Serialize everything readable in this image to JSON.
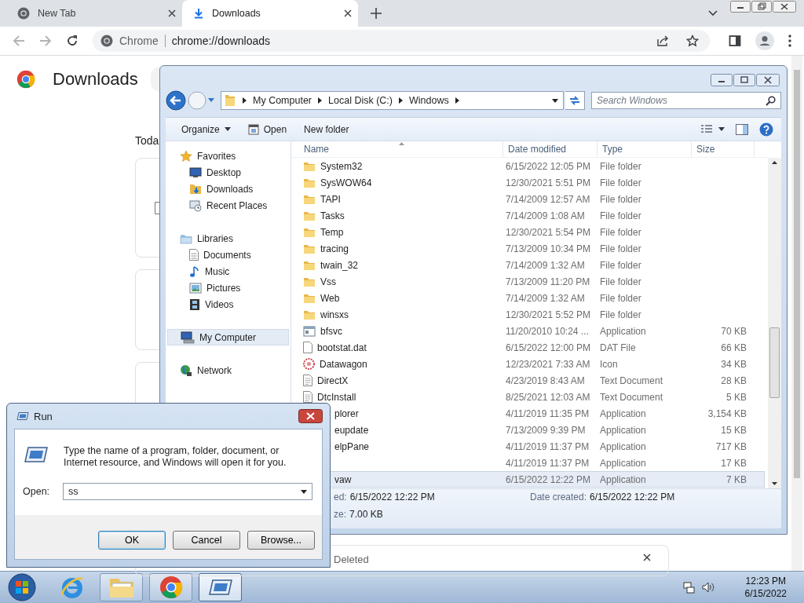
{
  "browser": {
    "tabs": [
      {
        "title": "New Tab",
        "kind": "chrome",
        "selected": false
      },
      {
        "title": "Downloads",
        "kind": "download",
        "selected": true
      }
    ],
    "omnibox": {
      "chip": "Chrome",
      "url": "chrome://downloads"
    },
    "page": {
      "title": "Downloads",
      "section": "Toda",
      "last_card_status": "Deleted"
    }
  },
  "explorer": {
    "breadcrumb": [
      "My Computer",
      "Local Disk (C:)",
      "Windows"
    ],
    "search_placeholder": "Search Windows",
    "toolbar": [
      {
        "label": "Organize",
        "kind": "menu"
      },
      {
        "label": "Open",
        "kind": "open"
      },
      {
        "label": "New folder",
        "kind": "plain"
      }
    ],
    "nav": [
      {
        "label": "Favorites",
        "kind": "star",
        "selected": false,
        "children": [
          {
            "label": "Desktop",
            "kind": "desktop",
            "selected": false
          },
          {
            "label": "Downloads",
            "kind": "downloads",
            "selected": false
          },
          {
            "label": "Recent Places",
            "kind": "recent",
            "selected": false
          }
        ]
      },
      {
        "label": "Libraries",
        "kind": "library",
        "selected": false,
        "children": [
          {
            "label": "Documents",
            "kind": "documents",
            "selected": false
          },
          {
            "label": "Music",
            "kind": "music",
            "selected": false
          },
          {
            "label": "Pictures",
            "kind": "pictures",
            "selected": false
          },
          {
            "label": "Videos",
            "kind": "videos",
            "selected": false
          }
        ]
      },
      {
        "label": "My Computer",
        "kind": "computer",
        "selected": true
      },
      {
        "label": "Network",
        "kind": "network",
        "selected": false
      }
    ],
    "columns": [
      "Name",
      "Date modified",
      "Type",
      "Size"
    ],
    "rows": [
      {
        "name": "System32",
        "kind": "folder",
        "date": "6/15/2022 12:05 PM",
        "type": "File folder",
        "selected": false
      },
      {
        "name": "SysWOW64",
        "kind": "folder",
        "date": "12/30/2021 5:51 PM",
        "type": "File folder",
        "selected": false
      },
      {
        "name": "TAPI",
        "kind": "folder",
        "date": "7/14/2009 12:57 AM",
        "type": "File folder",
        "selected": false
      },
      {
        "name": "Tasks",
        "kind": "folder",
        "date": "7/14/2009 1:08 AM",
        "type": "File folder",
        "selected": false
      },
      {
        "name": "Temp",
        "kind": "folder",
        "date": "12/30/2021 5:54 PM",
        "type": "File folder",
        "selected": false
      },
      {
        "name": "tracing",
        "kind": "folder",
        "date": "7/13/2009 10:34 PM",
        "type": "File folder",
        "selected": false
      },
      {
        "name": "twain_32",
        "kind": "folder",
        "date": "7/14/2009 1:32 AM",
        "type": "File folder",
        "selected": false
      },
      {
        "name": "Vss",
        "kind": "folder",
        "date": "7/13/2009 11:20 PM",
        "type": "File folder",
        "selected": false
      },
      {
        "name": "Web",
        "kind": "folder",
        "date": "7/14/2009 1:32 AM",
        "type": "File folder",
        "selected": false
      },
      {
        "name": "winsxs",
        "kind": "folder",
        "date": "12/30/2021 5:52 PM",
        "type": "File folder",
        "selected": false
      },
      {
        "name": "bfsvc",
        "kind": "application",
        "date": "11/20/2010 10:24 ...",
        "type": "Application",
        "size": "70 KB",
        "selected": false
      },
      {
        "name": "bootstat.dat",
        "kind": "file",
        "date": "6/15/2022 12:00 PM",
        "type": "DAT File",
        "size": "66 KB",
        "selected": false
      },
      {
        "name": "Datawagon",
        "kind": "image",
        "date": "12/23/2021 7:33 AM",
        "type": "Icon",
        "size": "34 KB",
        "selected": false
      },
      {
        "name": "DirectX",
        "kind": "text",
        "date": "4/23/2019 8:43 AM",
        "type": "Text Document",
        "size": "28 KB",
        "selected": false
      },
      {
        "name": "DtcInstall",
        "kind": "text",
        "date": "8/25/2021 12:03 AM",
        "type": "Text Document",
        "size": "5 KB",
        "selected": false
      },
      {
        "name": "plorer",
        "date": "4/11/2019 11:35 PM",
        "type": "Application",
        "size": "3,154 KB",
        "selected": false
      },
      {
        "name": "eupdate",
        "date": "7/13/2009 9:39 PM",
        "type": "Application",
        "size": "15 KB",
        "selected": false
      },
      {
        "name": "elpPane",
        "date": "4/11/2019 11:37 PM",
        "type": "Application",
        "size": "717 KB",
        "selected": false
      },
      {
        "date": "4/11/2019 11:37 PM",
        "type": "Application",
        "size": "17 KB",
        "selected": false
      },
      {
        "name": "vaw",
        "date": "6/15/2022 12:22 PM",
        "type": "Application",
        "size": "7 KB",
        "selected": true
      }
    ],
    "details": [
      {
        "label": "ed:",
        "value": "6/15/2022 12:22 PM"
      },
      {
        "label": "Date created:",
        "value": "6/15/2022 12:22 PM"
      },
      {
        "label": "ze:",
        "value": "7.00 KB"
      }
    ]
  },
  "run": {
    "title": "Run",
    "message": "Type the name of a program, folder, document, or Internet resource, and Windows will open it for you.",
    "open_label": "Open:",
    "value": "ss",
    "buttons": [
      {
        "label": "OK",
        "default": true
      },
      {
        "label": "Cancel",
        "default": false
      },
      {
        "label": "Browse...",
        "default": false
      }
    ]
  },
  "taskbar": {
    "apps": [
      {
        "kind": "ie",
        "selected": false
      },
      {
        "kind": "explorer",
        "selected": false
      },
      {
        "kind": "chrome",
        "selected": false
      },
      {
        "kind": "run",
        "selected": true
      }
    ],
    "time": "12:23 PM",
    "date": "6/15/2022"
  }
}
